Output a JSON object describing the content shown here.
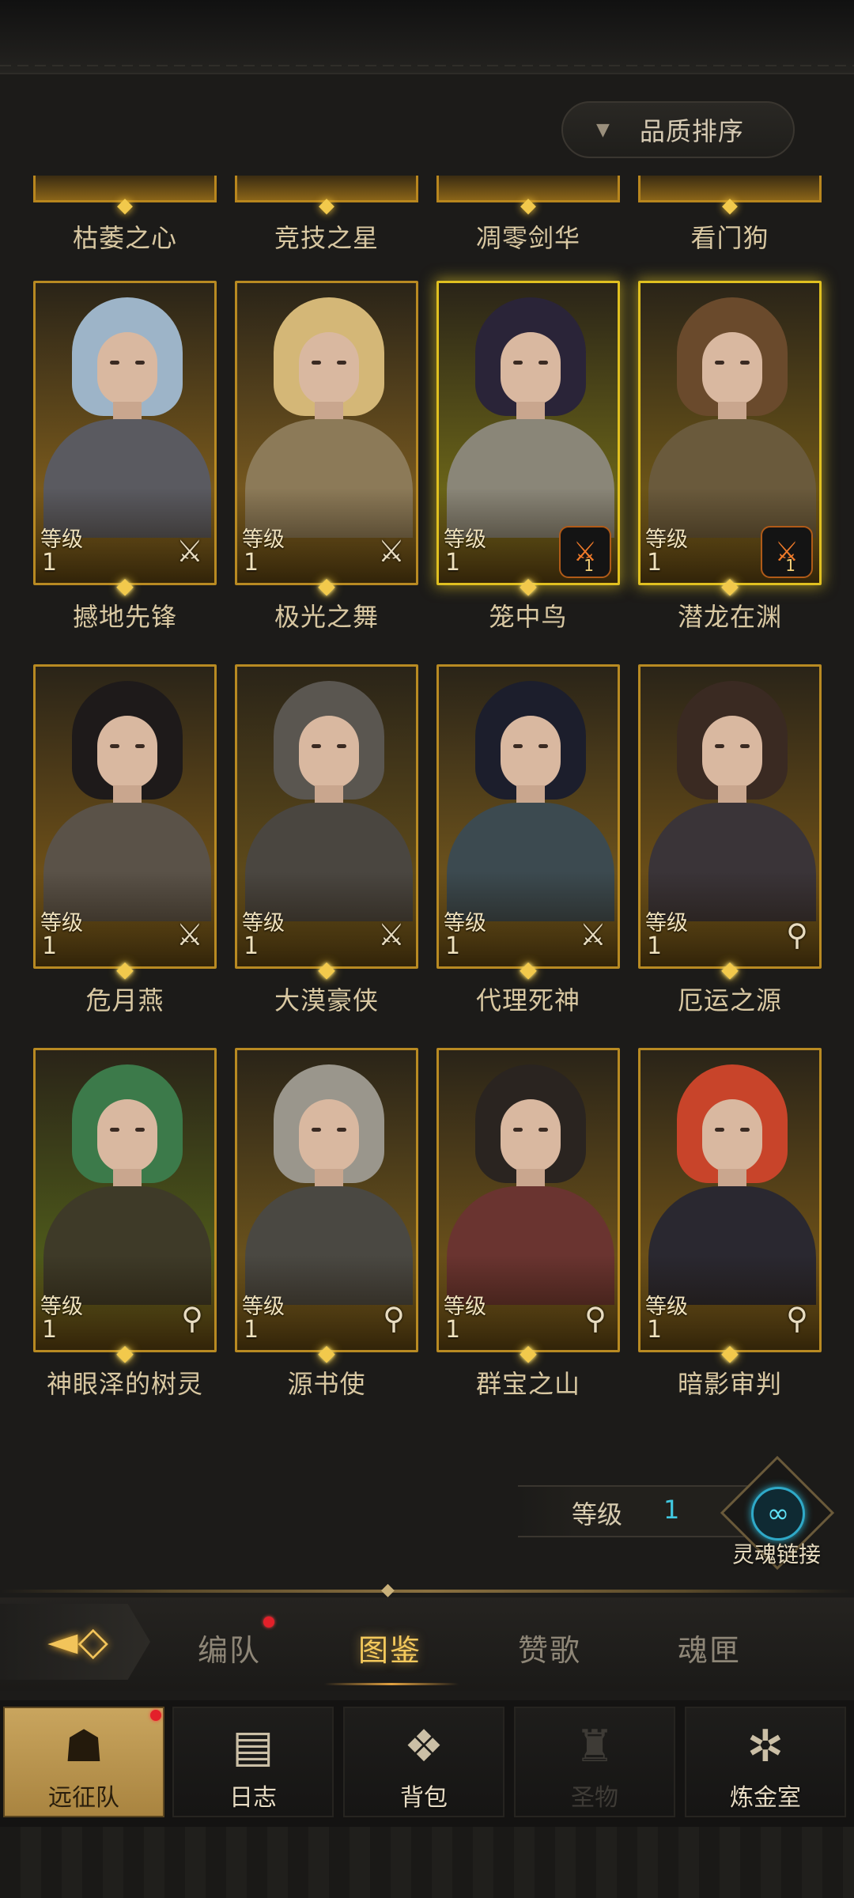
{
  "sort": {
    "label": "品质排序"
  },
  "partial_row": {
    "names": [
      "枯萎之心",
      "竞技之星",
      "凋零剑华",
      "看门狗"
    ]
  },
  "cards": [
    {
      "name": "撼地先锋",
      "level_label": "等级",
      "level": "1",
      "role_icon": "sword-icon",
      "badge": false,
      "palette": {
        "bg": "#7a5a1c",
        "hair": "#9db4c8",
        "body": "#5a5a60"
      }
    },
    {
      "name": "极光之舞",
      "level_label": "等级",
      "level": "1",
      "role_icon": "sword-icon",
      "badge": false,
      "palette": {
        "bg": "#76581f",
        "hair": "#d4b777",
        "body": "#8c7a58"
      }
    },
    {
      "name": "笼中鸟",
      "level_label": "等级",
      "level": "1",
      "role_icon": "sword-icon",
      "badge": true,
      "badge_level": "1",
      "palette": {
        "bg": "#6a6418",
        "hair": "#2a2438",
        "body": "#8a8678"
      }
    },
    {
      "name": "潜龙在渊",
      "level_label": "等级",
      "level": "1",
      "role_icon": "sword-icon",
      "badge": true,
      "badge_level": "1",
      "palette": {
        "bg": "#6c5518",
        "hair": "#6a4a2c",
        "body": "#6a5a3c"
      }
    },
    {
      "name": "危月燕",
      "level_label": "等级",
      "level": "1",
      "role_icon": "sword-icon",
      "badge": false,
      "palette": {
        "bg": "#6e5018",
        "hair": "#1e1a1a",
        "body": "#5a5248"
      }
    },
    {
      "name": "大漠豪侠",
      "level_label": "等级",
      "level": "1",
      "role_icon": "sword-icon",
      "badge": false,
      "palette": {
        "bg": "#5e4a1a",
        "hair": "#5a5650",
        "body": "#4a4640"
      }
    },
    {
      "name": "代理死神",
      "level_label": "等级",
      "level": "1",
      "role_icon": "sword-icon",
      "badge": false,
      "palette": {
        "bg": "#6c521c",
        "hair": "#1c1e2c",
        "body": "#3c4a50"
      }
    },
    {
      "name": "厄运之源",
      "level_label": "等级",
      "level": "1",
      "role_icon": "staff-icon",
      "badge": false,
      "palette": {
        "bg": "#6a4e18",
        "hair": "#3a2a22",
        "body": "#3a3438"
      }
    },
    {
      "name": "神眼泽的树灵",
      "level_label": "等级",
      "level": "1",
      "role_icon": "staff-icon",
      "badge": false,
      "palette": {
        "bg": "#4e5a1a",
        "hair": "#3c7a4a",
        "body": "#3e3a28"
      }
    },
    {
      "name": "源书使",
      "level_label": "等级",
      "level": "1",
      "role_icon": "staff-icon",
      "badge": false,
      "palette": {
        "bg": "#6a521c",
        "hair": "#9a968c",
        "body": "#4a4842"
      }
    },
    {
      "name": "群宝之山",
      "level_label": "等级",
      "level": "1",
      "role_icon": "staff-icon",
      "badge": false,
      "palette": {
        "bg": "#6a501a",
        "hair": "#2a2420",
        "body": "#6a3430"
      }
    },
    {
      "name": "暗影审判",
      "level_label": "等级",
      "level": "1",
      "role_icon": "staff-icon",
      "badge": false,
      "palette": {
        "bg": "#6c5018",
        "hair": "#c8442a",
        "body": "#2a2830"
      }
    }
  ],
  "level_filter": {
    "label": "等级",
    "value": "1"
  },
  "soul_link": {
    "label": "灵魂链接"
  },
  "subnav": {
    "tabs": [
      "编队",
      "图鉴",
      "赞歌",
      "魂匣"
    ],
    "active": "图鉴"
  },
  "bottom_nav": [
    {
      "label": "远征队",
      "icon": "helmet-icon",
      "active": true,
      "dot": true
    },
    {
      "label": "日志",
      "icon": "scroll-icon",
      "active": false,
      "dot": false
    },
    {
      "label": "背包",
      "icon": "bag-icon",
      "active": false,
      "dot": false
    },
    {
      "label": "圣物",
      "icon": "relic-icon",
      "active": false,
      "disabled": true,
      "dot": false
    },
    {
      "label": "炼金室",
      "icon": "alchemy-icon",
      "active": false,
      "dot": false
    }
  ],
  "colors": {
    "gold": "#f2c94c",
    "cyan": "#41c8e0",
    "red_dot": "#e3202a"
  }
}
